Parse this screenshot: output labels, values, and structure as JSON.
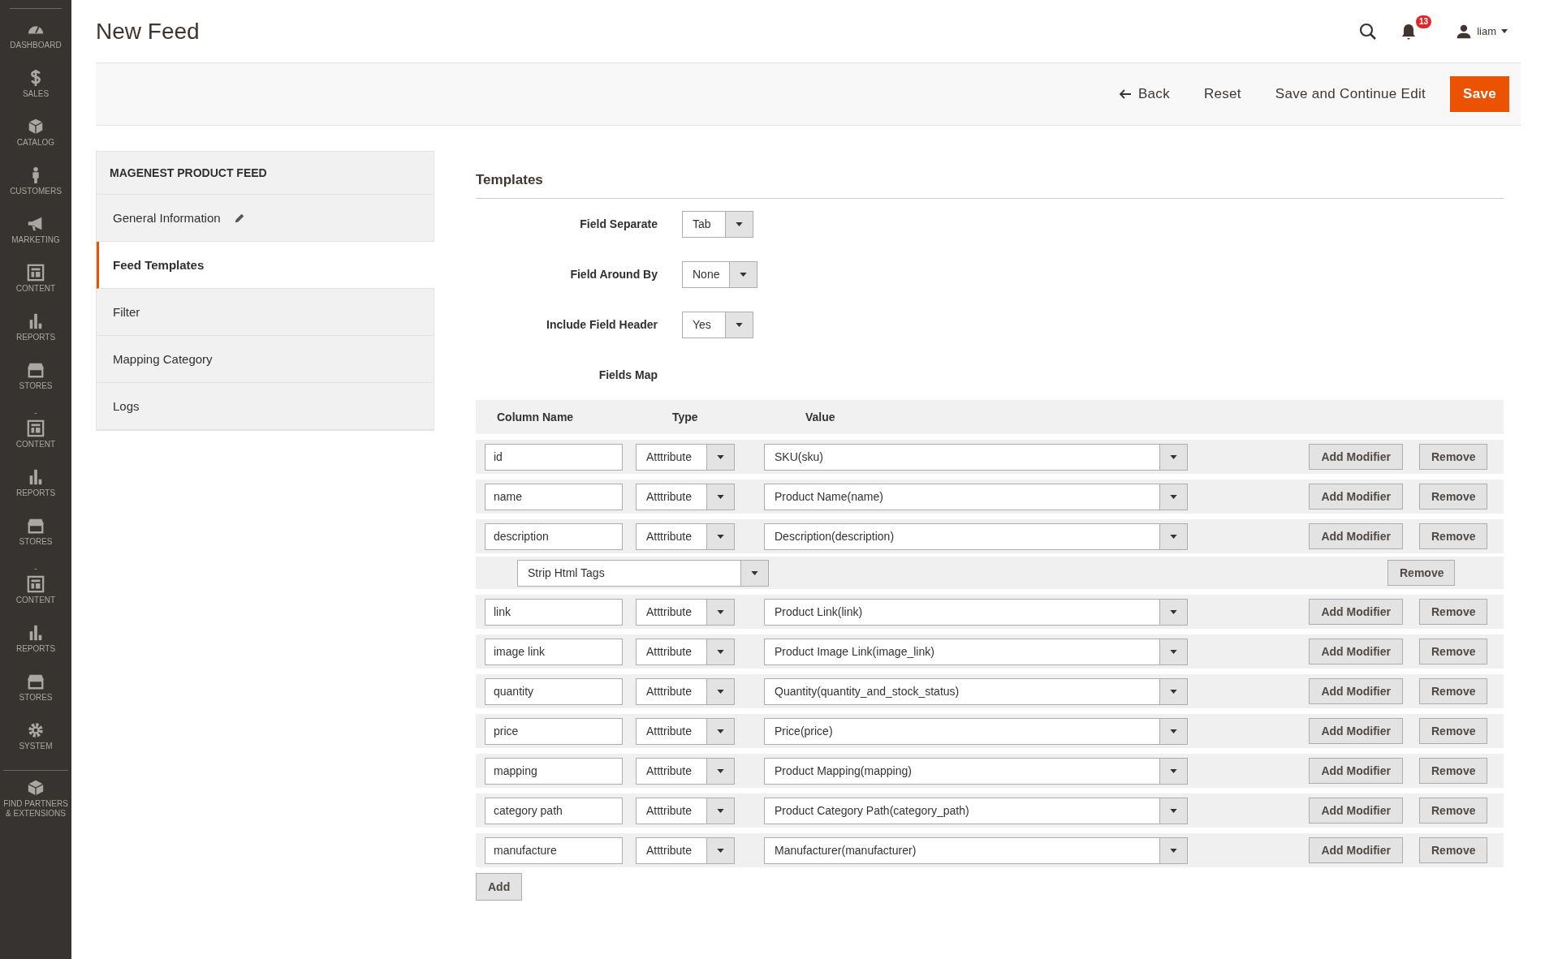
{
  "nav": [
    {
      "label": "DASHBOARD",
      "kind": "dashboard"
    },
    {
      "label": "SALES",
      "kind": "sales"
    },
    {
      "label": "CATALOG",
      "kind": "catalog"
    },
    {
      "label": "CUSTOMERS",
      "kind": "customers"
    },
    {
      "label": "MARKETING",
      "kind": "marketing"
    },
    {
      "label": "CONTENT",
      "kind": "content"
    },
    {
      "label": "REPORTS",
      "kind": "reports"
    },
    {
      "label": "STORES",
      "kind": "stores"
    },
    {
      "label": "-",
      "kind": "separator"
    },
    {
      "label": "CONTENT",
      "kind": "content"
    },
    {
      "label": "REPORTS",
      "kind": "reports"
    },
    {
      "label": "STORES",
      "kind": "stores"
    },
    {
      "label": "-",
      "kind": "separator"
    },
    {
      "label": "CONTENT",
      "kind": "content"
    },
    {
      "label": "REPORTS",
      "kind": "reports"
    },
    {
      "label": "STORES",
      "kind": "stores"
    },
    {
      "label": "SYSTEM",
      "kind": "system"
    },
    {
      "label": "FIND PARTNERS & EXTENSIONS",
      "kind": "partners"
    }
  ],
  "page_title": "New Feed",
  "header": {
    "notifications": "13",
    "user": "liam"
  },
  "actions": [
    {
      "label": "Back",
      "kind": "back"
    },
    {
      "label": "Reset",
      "kind": "plain"
    },
    {
      "label": "Save and Continue Edit",
      "kind": "plain"
    },
    {
      "label": "Save",
      "kind": "primary"
    }
  ],
  "panel": {
    "title": "MAGENEST PRODUCT FEED",
    "items": [
      {
        "label": "General Information",
        "selected": false,
        "edited": true
      },
      {
        "label": "Feed Templates",
        "selected": true,
        "edited": false
      },
      {
        "label": "Filter",
        "selected": false,
        "edited": false
      },
      {
        "label": "Mapping Category",
        "selected": false,
        "edited": false
      },
      {
        "label": "Logs",
        "selected": false,
        "edited": false
      }
    ]
  },
  "section_title": "Templates",
  "settings": [
    {
      "label": "Field Separate",
      "value": "Tab"
    },
    {
      "label": "Field Around By",
      "value": "None"
    },
    {
      "label": "Include Field Header",
      "value": "Yes"
    }
  ],
  "fields_map": {
    "label": "Fields Map",
    "columns": [
      "Column Name",
      "Type",
      "Value"
    ],
    "rows": [
      {
        "column": "id",
        "type": "Atttribute",
        "value": "SKU(sku)",
        "add_modifier": "Add Modifier",
        "remove": "Remove",
        "modifiers": []
      },
      {
        "column": "name",
        "type": "Atttribute",
        "value": "Product Name(name)",
        "add_modifier": "Add Modifier",
        "remove": "Remove",
        "modifiers": []
      },
      {
        "column": "description",
        "type": "Atttribute",
        "value": "Description(description)",
        "add_modifier": "Add Modifier",
        "remove": "Remove",
        "modifiers": [
          {
            "value": "Strip Html Tags",
            "remove": "Remove"
          }
        ]
      },
      {
        "column": "link",
        "type": "Atttribute",
        "value": "Product Link(link)",
        "add_modifier": "Add Modifier",
        "remove": "Remove",
        "modifiers": []
      },
      {
        "column": "image link",
        "type": "Atttribute",
        "value": "Product Image Link(image_link)",
        "add_modifier": "Add Modifier",
        "remove": "Remove",
        "modifiers": []
      },
      {
        "column": "quantity",
        "type": "Atttribute",
        "value": "Quantity(quantity_and_stock_status)",
        "add_modifier": "Add Modifier",
        "remove": "Remove",
        "modifiers": []
      },
      {
        "column": "price",
        "type": "Atttribute",
        "value": "Price(price)",
        "add_modifier": "Add Modifier",
        "remove": "Remove",
        "modifiers": []
      },
      {
        "column": "mapping",
        "type": "Atttribute",
        "value": "Product Mapping(mapping)",
        "add_modifier": "Add Modifier",
        "remove": "Remove",
        "modifiers": []
      },
      {
        "column": "category path",
        "type": "Atttribute",
        "value": "Product Category Path(category_path)",
        "add_modifier": "Add Modifier",
        "remove": "Remove",
        "modifiers": []
      },
      {
        "column": "manufacture",
        "type": "Atttribute",
        "value": "Manufacturer(manufacturer)",
        "add_modifier": "Add Modifier",
        "remove": "Remove",
        "modifiers": []
      }
    ],
    "add": "Add"
  }
}
